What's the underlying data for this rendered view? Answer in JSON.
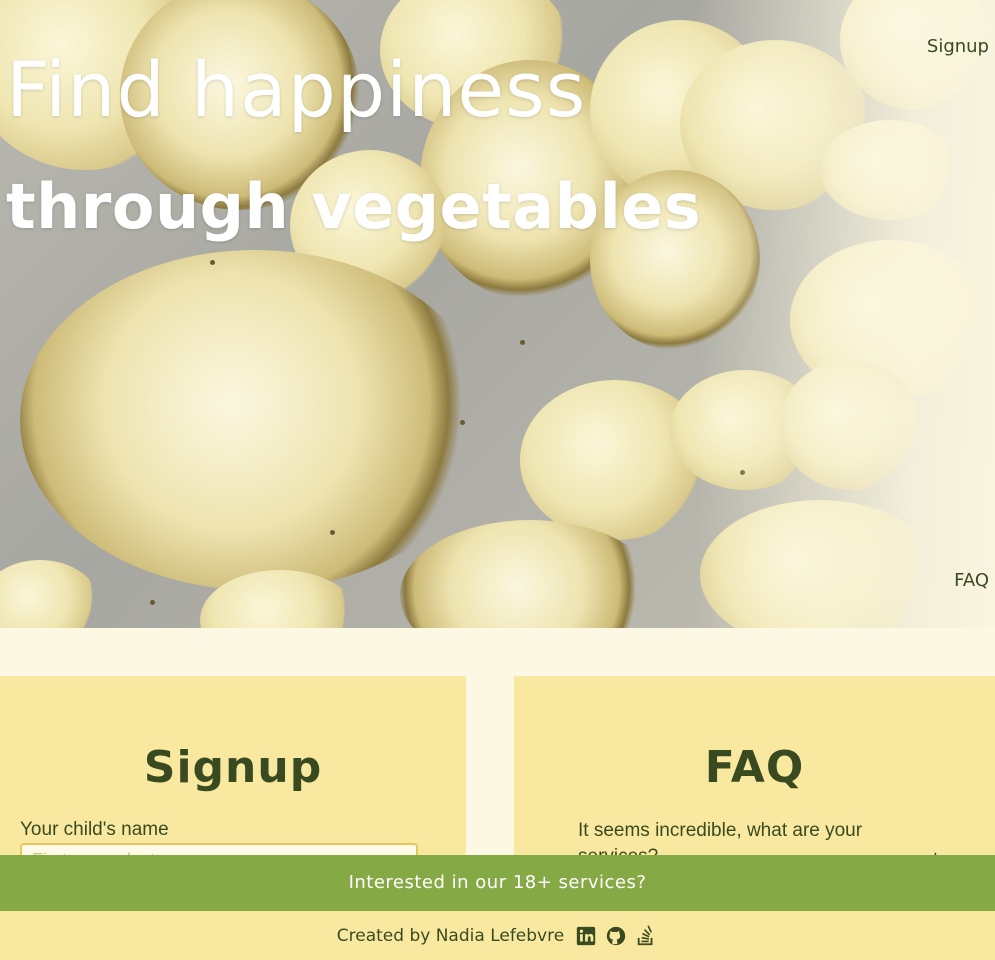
{
  "hero": {
    "title": "Find happiness",
    "subtitle": "through vegetables",
    "image_alt": "roasted cauliflower slices on a baking tray"
  },
  "nav": {
    "signup": "Signup",
    "faq": "FAQ"
  },
  "signup": {
    "title": "Signup",
    "name_label": "Your child's name",
    "name_placeholder": "First name, last name",
    "name_value": ""
  },
  "faq": {
    "title": "FAQ",
    "question": "It seems incredible, what are your services?",
    "toggle": "+"
  },
  "promo": {
    "text": "Interested in our 18+ services?"
  },
  "footer": {
    "credit": "Created by Nadia Lefebvre",
    "icons": [
      "linkedin-icon",
      "github-icon",
      "stackoverflow-icon"
    ]
  },
  "colors": {
    "background": "#fcf8e3",
    "panel": "#f9e9a0",
    "accent_green": "#85aa45",
    "text_dark": "#3a4a20",
    "input_border": "#e6c85a"
  }
}
